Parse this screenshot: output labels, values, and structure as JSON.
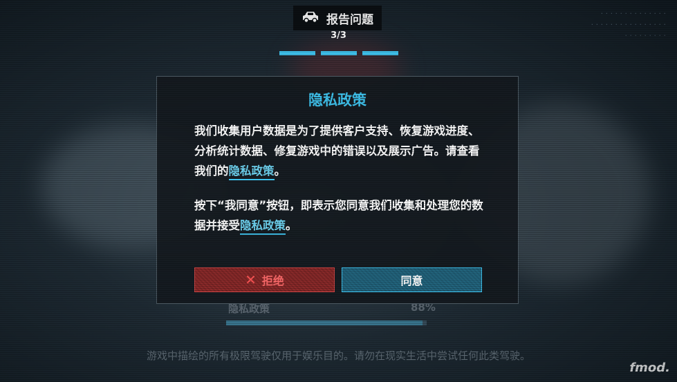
{
  "header": {
    "icon": "car-icon",
    "title": "报告问题",
    "step": "3/3",
    "progress_segments": 3,
    "progress_filled": 3
  },
  "dialog": {
    "title": "隐私政策",
    "paragraph1_text": "我们收集用户数据是为了提供客户支持、恢复游戏进度、分析统计数据、修复游戏中的错误以及展示广告。请查看我们的",
    "paragraph1_link": "隐私政策",
    "paragraph1_end": "。",
    "paragraph2_text": "按下“我同意”按钮，即表示您同意我们收集和处理您的数据并接受",
    "paragraph2_link": "隐私政策",
    "paragraph2_end": "。",
    "decline_label": "拒绝",
    "accept_label": "同意"
  },
  "background": {
    "under_label": "隐私政策",
    "under_percent": "88%",
    "under_progress": 0.98,
    "disclaimer": "游戏中描绘的所有极限驾驶仅用于娱乐目的。请勿在现实生活中尝试任何此类驾驶。",
    "logo": "fmod."
  },
  "colors": {
    "accent": "#3fc3ee",
    "decline": "#c94545",
    "dialog_bg": "#14191f"
  }
}
